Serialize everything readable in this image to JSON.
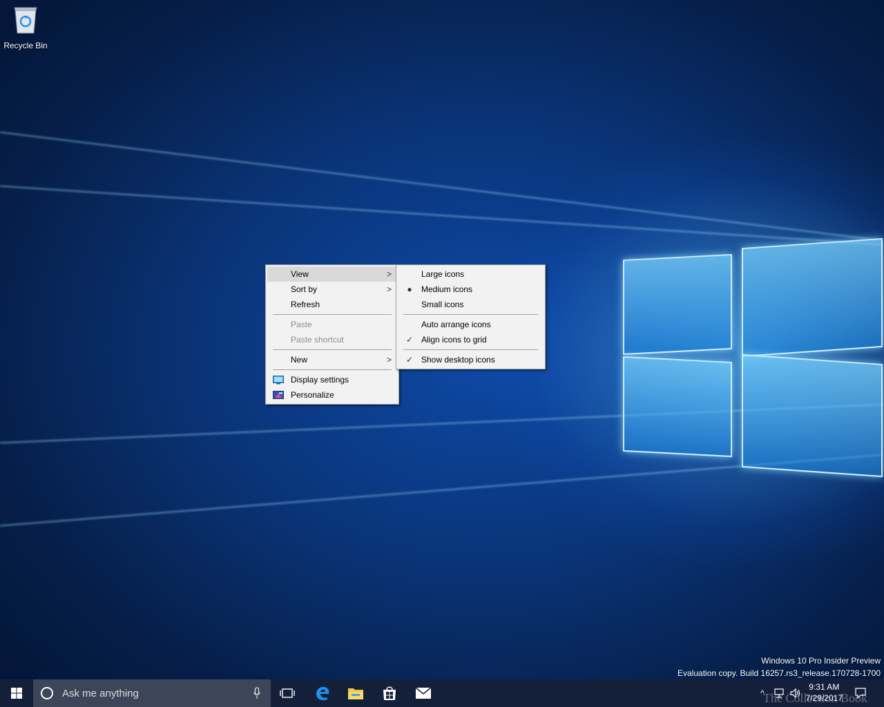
{
  "desktop": {
    "recycle_bin_label": "Recycle Bin",
    "watermark_line1": "Windows 10 Pro Insider Preview",
    "watermark_line2": "Evaluation copy. Build 16257.rs3_release.170728-1700",
    "brand_watermark": "The Collection Book"
  },
  "context_menu": {
    "items": [
      {
        "label": "View",
        "has_submenu": true,
        "highlighted": true
      },
      {
        "label": "Sort by",
        "has_submenu": true
      },
      {
        "label": "Refresh"
      },
      {
        "label": "Paste",
        "disabled": true
      },
      {
        "label": "Paste shortcut",
        "disabled": true
      },
      {
        "label": "New",
        "has_submenu": true
      },
      {
        "label": "Display settings",
        "icon": "display-icon"
      },
      {
        "label": "Personalize",
        "icon": "personalize-icon"
      }
    ]
  },
  "view_submenu": {
    "items": [
      {
        "label": "Large icons"
      },
      {
        "label": "Medium icons",
        "mark": "bullet"
      },
      {
        "label": "Small icons"
      },
      {
        "label": "Auto arrange icons"
      },
      {
        "label": "Align icons to grid",
        "mark": "check"
      },
      {
        "label": "Show desktop icons",
        "mark": "check"
      }
    ]
  },
  "taskbar": {
    "search_placeholder": "Ask me anything",
    "time": "9:31 AM",
    "date": "7/29/2017",
    "accent": "#0078d7"
  }
}
